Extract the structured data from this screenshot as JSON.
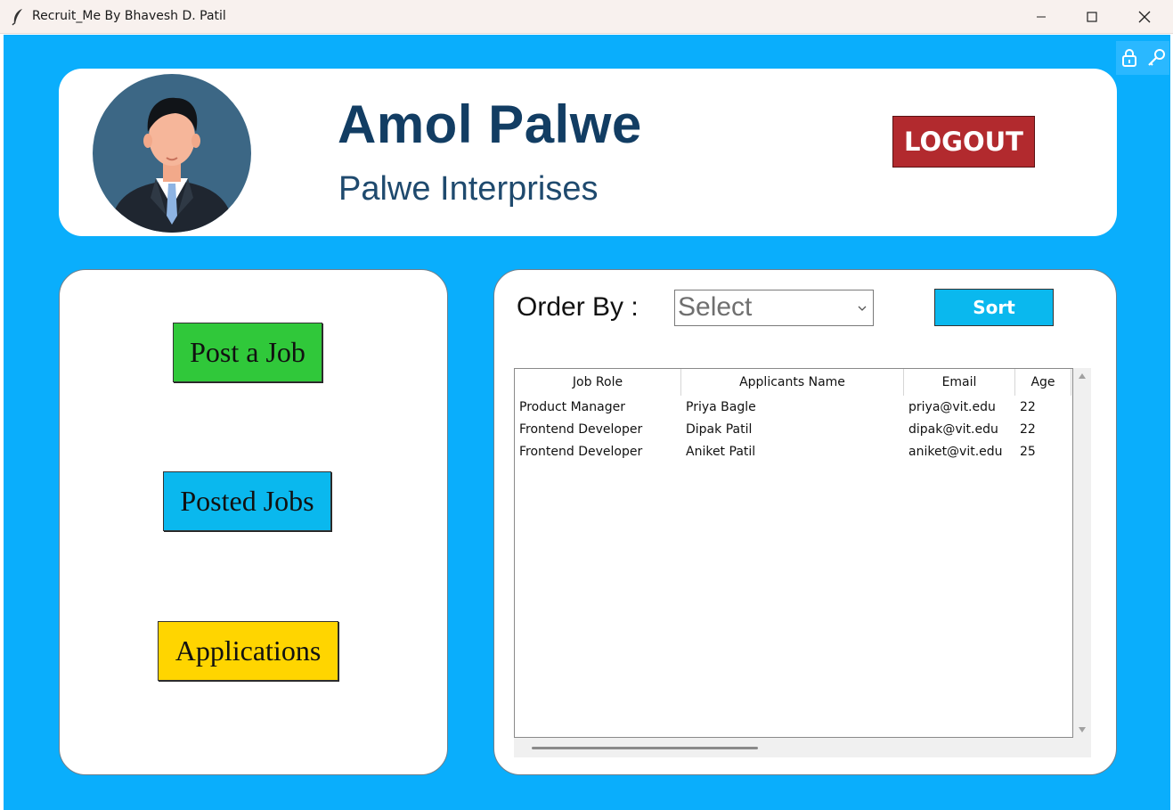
{
  "window": {
    "title": "Recruit_Me By Bhavesh D. Patil",
    "icons": [
      "feather-icon",
      "minimize-icon",
      "maximize-icon",
      "close-icon"
    ]
  },
  "colors": {
    "app_background": "#0aaefc",
    "name_text": "#123d63",
    "logout": "#b22a2e",
    "post_job": "#30c83a",
    "posted_jobs": "#0ab8ee",
    "applications": "#ffd500",
    "sort": "#0ab8ee"
  },
  "header": {
    "name": "Amol Palwe",
    "company": "Palwe Interprises",
    "logout_label": "LOGOUT"
  },
  "nav": {
    "post_job_label": "Post a Job",
    "posted_jobs_label": "Posted Jobs",
    "applications_label": "Applications"
  },
  "filters": {
    "order_label": "Order By :",
    "select_value": "Select",
    "sort_label": "Sort"
  },
  "table": {
    "columns": [
      "Job Role",
      "Applicants Name",
      "Email",
      "Age"
    ],
    "rows": [
      [
        "Product Manager",
        "Priya Bagle",
        "priya@vit.edu",
        "22"
      ],
      [
        "Frontend Developer",
        "Dipak Patil",
        "dipak@vit.edu",
        "22"
      ],
      [
        "Frontend Developer",
        "Aniket Patil",
        "aniket@vit.edu",
        "25"
      ]
    ]
  }
}
